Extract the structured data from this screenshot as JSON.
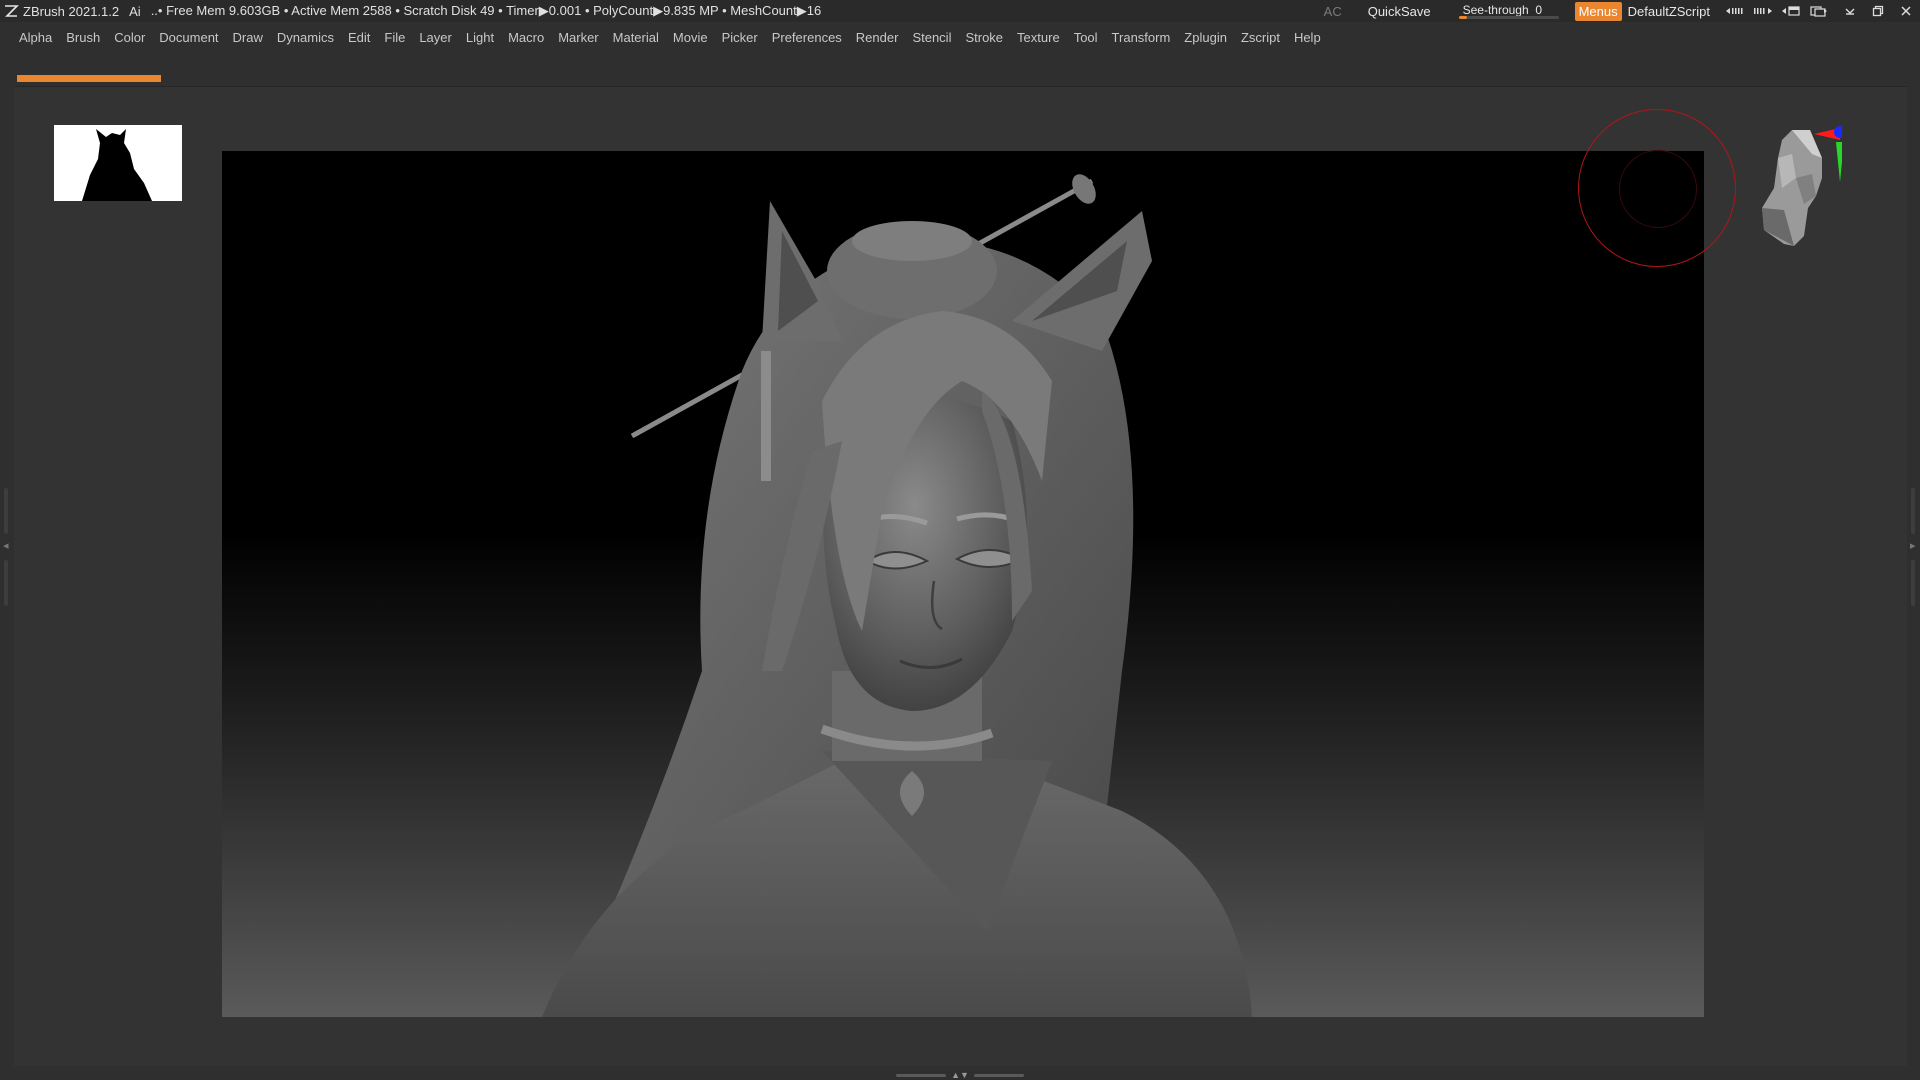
{
  "titlebar": {
    "app_title": "ZBrush 2021.1.2",
    "ai_label": "Ai",
    "stats": "..• Free Mem 9.603GB • Active Mem 2588 • Scratch Disk 49 •  Timer▶0.001 • PolyCount▶9.835 MP  • MeshCount▶16",
    "ac_label": "AC",
    "quicksave_label": "QuickSave",
    "see_through_label": "See-through",
    "see_through_value": "0",
    "see_through_fill": 0.08,
    "menus_label": "Menus",
    "script_label": "DefaultZScript"
  },
  "menubar": {
    "items": [
      "Alpha",
      "Brush",
      "Color",
      "Document",
      "Draw",
      "Dynamics",
      "Edit",
      "File",
      "Layer",
      "Light",
      "Macro",
      "Marker",
      "Material",
      "Movie",
      "Picker",
      "Preferences",
      "Render",
      "Stencil",
      "Stroke",
      "Texture",
      "Tool",
      "Transform",
      "Zplugin",
      "Zscript",
      "Help"
    ]
  },
  "colors": {
    "accent": "#e9862f",
    "background": "#2f2f2f",
    "brush_ring": "#b0151a",
    "axis_x": "#ff1a1a",
    "axis_y": "#27d827",
    "axis_z": "#1a2bff"
  },
  "icons": {
    "app": "zbrush-logo-icon",
    "nav": "navigation-head-icon"
  }
}
